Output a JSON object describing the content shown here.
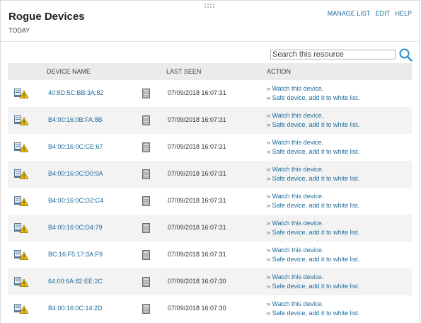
{
  "header": {
    "title": "Rogue Devices",
    "subtitle": "TODAY",
    "links": [
      "MANAGE LIST",
      "EDIT",
      "HELP"
    ]
  },
  "search": {
    "placeholder": "Search this resource",
    "icon": "search-icon"
  },
  "table": {
    "columns": [
      "DEVICE NAME",
      "LAST SEEN",
      "ACTION"
    ],
    "actions": [
      "» Watch this device.",
      "» Safe device, add it to white list."
    ],
    "rows": [
      {
        "mac": "40:8D:5C:BB:3A:82",
        "last_seen": "07/09/2018 16:07:31"
      },
      {
        "mac": "B4:00:16:0B:FA:8B",
        "last_seen": "07/09/2018 16:07:31"
      },
      {
        "mac": "B4:00:16:0C:CE:67",
        "last_seen": "07/09/2018 16:07:31"
      },
      {
        "mac": "B4:00:16:0C:D0:9A",
        "last_seen": "07/09/2018 16:07:31"
      },
      {
        "mac": "B4:00:16:0C:D2:C4",
        "last_seen": "07/09/2018 16:07:31"
      },
      {
        "mac": "B4:00:16:0C:D4:79",
        "last_seen": "07/09/2018 16:07:31"
      },
      {
        "mac": "BC:16:F5:17:3A:F9",
        "last_seen": "07/09/2018 16:07:31"
      },
      {
        "mac": "64:00:6A:82:EE:2C",
        "last_seen": "07/09/2018 16:07:30"
      },
      {
        "mac": "B4:00:16:0C:14:2D",
        "last_seen": "07/09/2018 16:07:30"
      }
    ]
  },
  "icons": {
    "device": "device-warning-icon",
    "database": "database-icon",
    "grip": "drag-handle-icon"
  },
  "colors": {
    "link": "#1f6a9a",
    "header_bg": "#ebebeb",
    "row_alt": "#f3f3f3",
    "warning": "#f2c200"
  }
}
